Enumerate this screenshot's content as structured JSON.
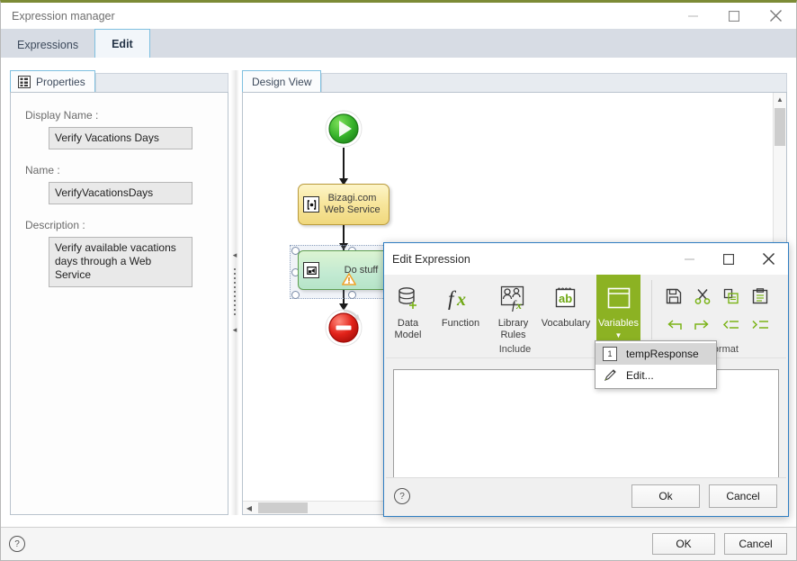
{
  "window": {
    "title": "Expression manager",
    "accent_top": "#7c8b36",
    "minimize": "minimize",
    "maximize": "maximize",
    "close": "close"
  },
  "tabs": [
    {
      "label": "Expressions",
      "active": false
    },
    {
      "label": "Edit",
      "active": true
    }
  ],
  "properties_panel": {
    "tab_label": "Properties",
    "fields": [
      {
        "label": "Display Name :",
        "value": "Verify Vacations Days"
      },
      {
        "label": "Name :",
        "value": "VerifyVacationsDays"
      },
      {
        "label": "Description :",
        "value": "Verify available vacations days through a Web Service"
      }
    ]
  },
  "design_view": {
    "tab_label": "Design View",
    "nodes": [
      {
        "type": "start-event",
        "label": ""
      },
      {
        "type": "service-task",
        "label": "Bizagi.com\nWeb Service",
        "line1": "Bizagi.com",
        "line2": "Web Service"
      },
      {
        "type": "task",
        "label": "Do stuff",
        "selected": true,
        "warning": true
      },
      {
        "type": "end-event",
        "label": ""
      }
    ]
  },
  "main_buttons": {
    "help": "?",
    "ok": "OK",
    "cancel": "Cancel"
  },
  "dialog": {
    "title": "Edit Expression",
    "minimize": "minimize",
    "maximize": "maximize",
    "close": "close",
    "ribbon": {
      "include_group_label": "Include",
      "format_group_label": "Format",
      "buttons": [
        {
          "label": "Data Model",
          "line1": "Data",
          "line2": "Model",
          "icon": "database-plus-icon",
          "active": false
        },
        {
          "label": "Function",
          "line1": "Function",
          "line2": "",
          "icon": "function-fx-icon",
          "active": false
        },
        {
          "label": "Library Rules",
          "line1": "Library",
          "line2": "Rules",
          "icon": "library-rules-icon",
          "active": false
        },
        {
          "label": "Vocabulary",
          "line1": "Vocabulary",
          "line2": "",
          "icon": "vocabulary-ab-icon",
          "active": false
        },
        {
          "label": "Variables",
          "line1": "Variables",
          "line2": "",
          "icon": "variables-icon",
          "active": true
        }
      ],
      "format_buttons": [
        {
          "label": "Save",
          "icon": "save-disk-icon"
        },
        {
          "label": "Cut",
          "icon": "scissors-icon"
        },
        {
          "label": "Copy",
          "icon": "copy-icon"
        },
        {
          "label": "Paste",
          "icon": "paste-icon"
        },
        {
          "label": "Undo",
          "icon": "undo-icon"
        },
        {
          "label": "Redo",
          "icon": "redo-icon"
        },
        {
          "label": "Outdent",
          "icon": "outdent-icon"
        },
        {
          "label": "Indent",
          "icon": "indent-icon"
        }
      ]
    },
    "dropdown": {
      "items": [
        {
          "label": "tempResponse",
          "icon": "number-one-icon",
          "badge": "1",
          "highlighted": true
        },
        {
          "label": "Edit...",
          "icon": "pencil-icon",
          "badge": "",
          "highlighted": false
        }
      ]
    },
    "editor_value": "",
    "help": "?",
    "ok": "Ok",
    "cancel": "Cancel"
  }
}
